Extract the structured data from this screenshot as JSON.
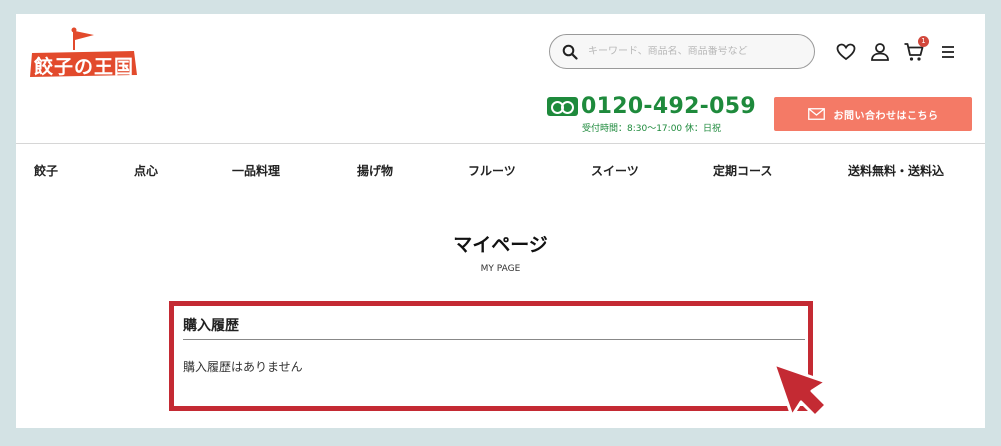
{
  "brand": {
    "logo_text": "餃子の王国",
    "accent": "#e24a2c"
  },
  "header": {
    "search": {
      "placeholder": "キーワード、商品名、商品番号など",
      "icon": "search-icon"
    },
    "icons": [
      "heart-icon",
      "user-icon",
      "cart-icon",
      "menu-icon"
    ],
    "cart_count": "1",
    "phone": {
      "number": "0120-492-059",
      "hours": "受付時間：8:30〜17:00 休：日祝",
      "color": "#1e8a3c"
    },
    "contact_button": {
      "label": "お問い合わせはこちら",
      "color": "#f47a66"
    }
  },
  "nav": {
    "items": [
      {
        "label": "餃子"
      },
      {
        "label": "点心"
      },
      {
        "label": "一品料理"
      },
      {
        "label": "揚げ物"
      },
      {
        "label": "フルーツ"
      },
      {
        "label": "スイーツ"
      },
      {
        "label": "定期コース"
      },
      {
        "label": "送料無料・送料込"
      }
    ]
  },
  "main": {
    "title": "マイページ",
    "subtitle": "MY PAGE",
    "history": {
      "heading": "購入履歴",
      "empty_message": "購入履歴はありません",
      "highlight_color": "#c42a33"
    }
  }
}
